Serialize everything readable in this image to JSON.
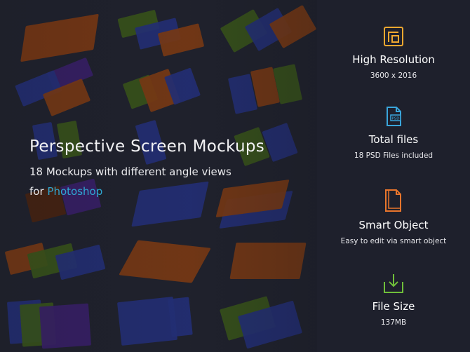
{
  "hero": {
    "title": "Perspective Screen Mockups",
    "subtitle": "18 Mockups with different angle views",
    "for_prefix": "for",
    "for_app": "Photoshop"
  },
  "features": [
    {
      "icon": "resolution-frame-icon",
      "title": "High Resolution",
      "desc": "3600 x 2016",
      "color": "#f0a830"
    },
    {
      "icon": "psd-file-icon",
      "title": "Total files",
      "desc": "18 PSD Files included",
      "color": "#3aa6dc"
    },
    {
      "icon": "smart-object-icon",
      "title": "Smart Object",
      "desc": "Easy to edit via smart object",
      "color": "#e8752c"
    },
    {
      "icon": "download-icon",
      "title": "File Size",
      "desc": "137MB",
      "color": "#6fbf3a"
    }
  ],
  "colors": {
    "accent_blue": "#2fa8d3",
    "background": "#1e202c",
    "mockup_orange": "#8a3e10",
    "mockup_green": "#3d5a1c",
    "mockup_blue": "#22307a",
    "mockup_purple": "#3a1f6a"
  }
}
